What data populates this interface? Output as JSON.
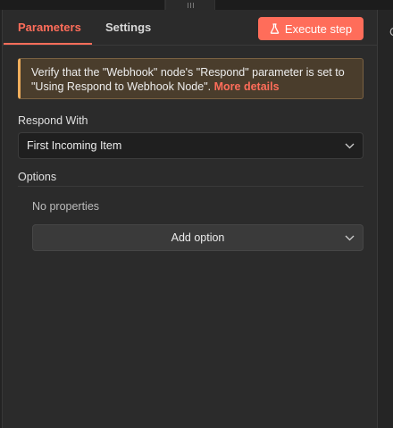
{
  "tabs": {
    "parameters": "Parameters",
    "settings": "Settings"
  },
  "execute_button": {
    "label": "Execute step",
    "icon": "flask-icon"
  },
  "warning": {
    "message": "Verify that the \"Webhook\" node's \"Respond\" parameter is set to \"Using Respond to Webhook Node\".",
    "link": "More details"
  },
  "respond_with": {
    "label": "Respond With",
    "value": "First Incoming Item"
  },
  "options": {
    "label": "Options",
    "empty_text": "No properties",
    "add_label": "Add option"
  },
  "right_panel": {
    "peek_text": "C"
  },
  "colors": {
    "accent": "#ff6d5a",
    "warning_border": "#f0ae5c",
    "panel_bg": "#2b2b2b"
  }
}
